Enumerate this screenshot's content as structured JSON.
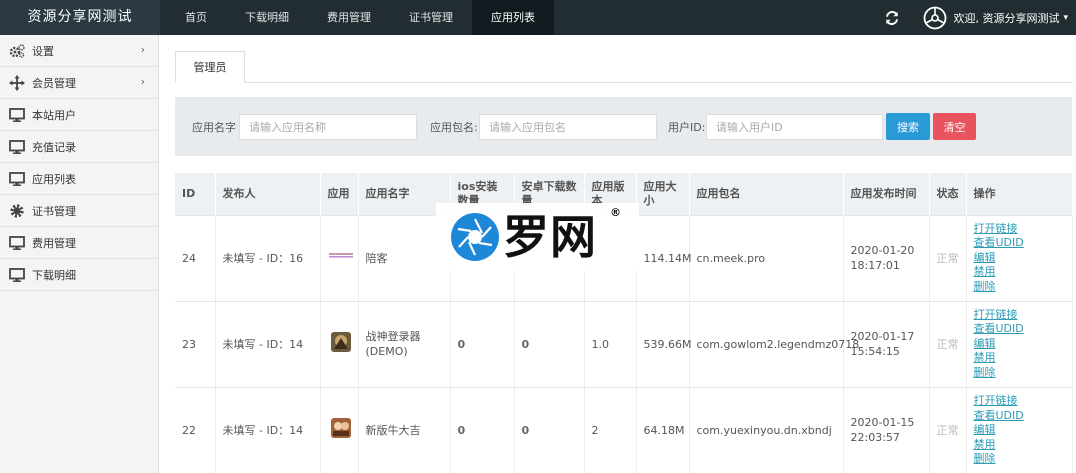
{
  "header": {
    "brand": "资源分享网测试",
    "nav": [
      "首页",
      "下载明细",
      "费用管理",
      "证书管理",
      "应用列表"
    ],
    "active_nav": "应用列表",
    "user_text": "欢迎, 资源分享网测试",
    "caret": "▾"
  },
  "sidebar": {
    "items": [
      {
        "icon": "gears-icon",
        "label": "设置",
        "arrow": "›"
      },
      {
        "icon": "move-icon",
        "label": "会员管理",
        "arrow": "›"
      },
      {
        "icon": "monitor-icon",
        "label": "本站用户"
      },
      {
        "icon": "monitor-icon",
        "label": "充值记录"
      },
      {
        "icon": "monitor-icon",
        "label": "应用列表"
      },
      {
        "icon": "gear-icon",
        "label": "证书管理"
      },
      {
        "icon": "monitor-icon",
        "label": "费用管理"
      },
      {
        "icon": "monitor-icon",
        "label": "下载明细"
      }
    ]
  },
  "tabs": {
    "active": "管理员"
  },
  "filter": {
    "app_name_label": "应用名字",
    "app_name_placeholder": "请输入应用名称",
    "package_label": "应用包名:",
    "package_placeholder": "请输入应用包名",
    "user_id_label": "用户ID:",
    "user_id_placeholder": "请输入用户ID",
    "search_button": "搜索",
    "clear_button": "清空"
  },
  "table": {
    "headers": [
      "ID",
      "发布人",
      "应用",
      "应用名字",
      "ios安装数量",
      "安卓下载数量",
      "应用版本",
      "应用大小",
      "应用包名",
      "应用发布时间",
      "状态",
      "操作"
    ],
    "rows": [
      {
        "id": "24",
        "publisher": "未填写 - ID：16",
        "name": "陪客",
        "ios": "",
        "android": "",
        "version": "",
        "size": "114.14M",
        "package": "cn.meek.pro",
        "date": "2020-01-20",
        "time": "18:17:01",
        "state": "正常"
      },
      {
        "id": "23",
        "publisher": "未填写 - ID：14",
        "name": "战神登录器(DEMO)",
        "ios": "0",
        "android": "0",
        "version": "1.0",
        "size": "539.66M",
        "package": "com.gowlom2.legendmz0718",
        "date": "2020-01-17",
        "time": "15:54:15",
        "state": "正常"
      },
      {
        "id": "22",
        "publisher": "未填写 - ID：14",
        "name": "新版牛大吉",
        "ios": "0",
        "android": "0",
        "version": "2",
        "size": "64.18M",
        "package": "com.yuexinyou.dn.xbndj",
        "date": "2020-01-15",
        "time": "22:03:57",
        "state": "正常"
      }
    ],
    "ops": [
      "打开链接",
      "查看UDID",
      "编辑",
      "禁用",
      "删除"
    ]
  },
  "watermark": {
    "text": "罗网",
    "reg": "®"
  }
}
